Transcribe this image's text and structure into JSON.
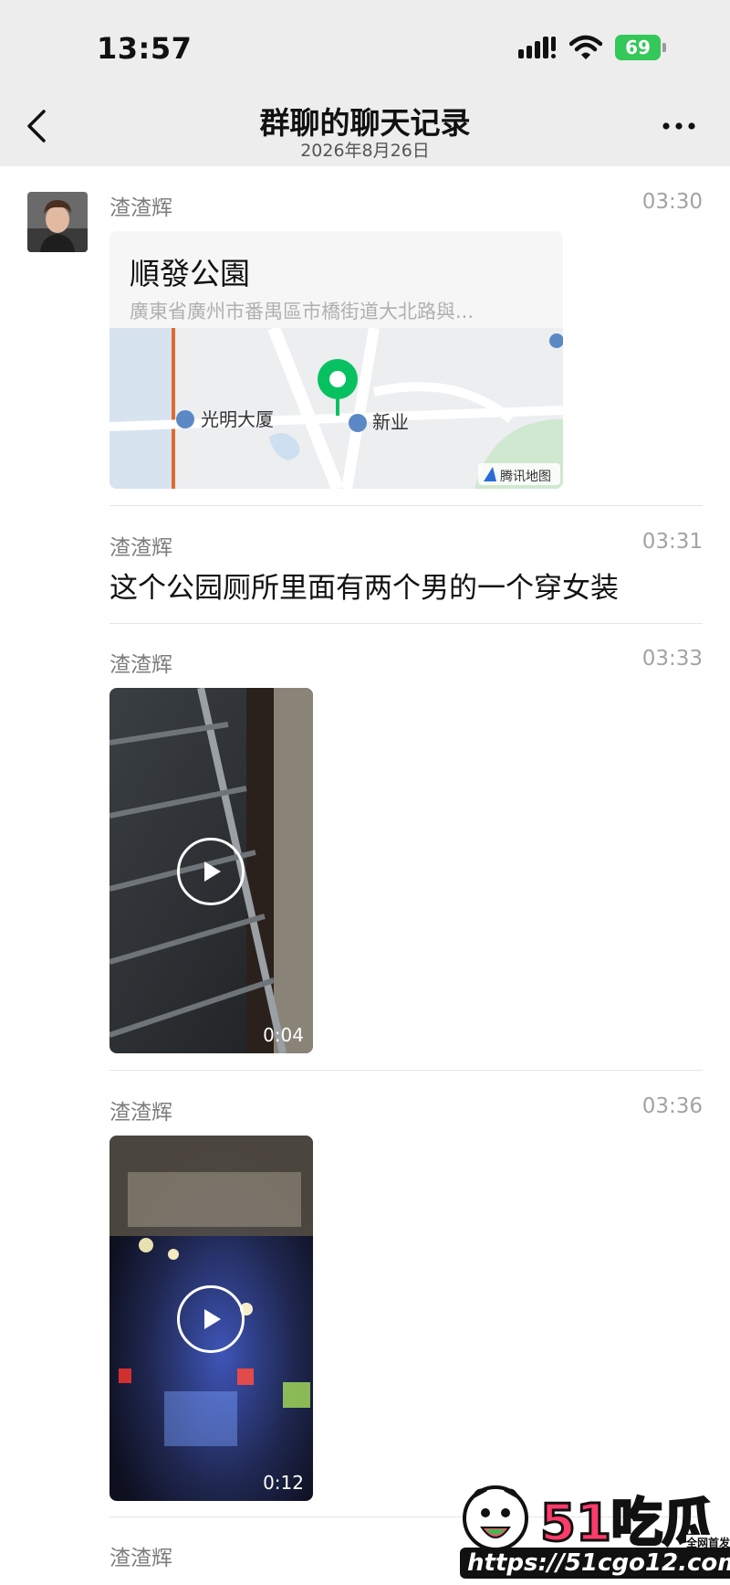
{
  "status_bar": {
    "time": "13:57",
    "battery": "69"
  },
  "nav": {
    "title": "群聊的聊天记录",
    "subtitle": "2026年8月26日"
  },
  "messages": [
    {
      "sender": "渣渣辉",
      "time": "03:30",
      "type": "location",
      "location": {
        "name": "順發公園",
        "address": "廣東省廣州市番禺區市橋街道大北路與...",
        "map_labels": [
          "光明大厦",
          "新业"
        ],
        "map_provider": "腾讯地图"
      }
    },
    {
      "sender": "渣渣辉",
      "time": "03:31",
      "type": "text",
      "text": "这个公园厕所里面有两个男的一个穿女装"
    },
    {
      "sender": "渣渣辉",
      "time": "03:33",
      "type": "video",
      "duration": "0:04"
    },
    {
      "sender": "渣渣辉",
      "time": "03:36",
      "type": "video",
      "duration": "0:12"
    },
    {
      "sender": "渣渣辉",
      "type": "text"
    }
  ],
  "watermark": {
    "logo": "51吃瓜",
    "url": "https://51cgo12.com",
    "badge": "全网首发"
  },
  "icons": [
    "back-chevron-icon",
    "more-dots-icon",
    "signal-icon",
    "wifi-icon",
    "battery-icon",
    "map-pin-icon",
    "play-icon"
  ]
}
